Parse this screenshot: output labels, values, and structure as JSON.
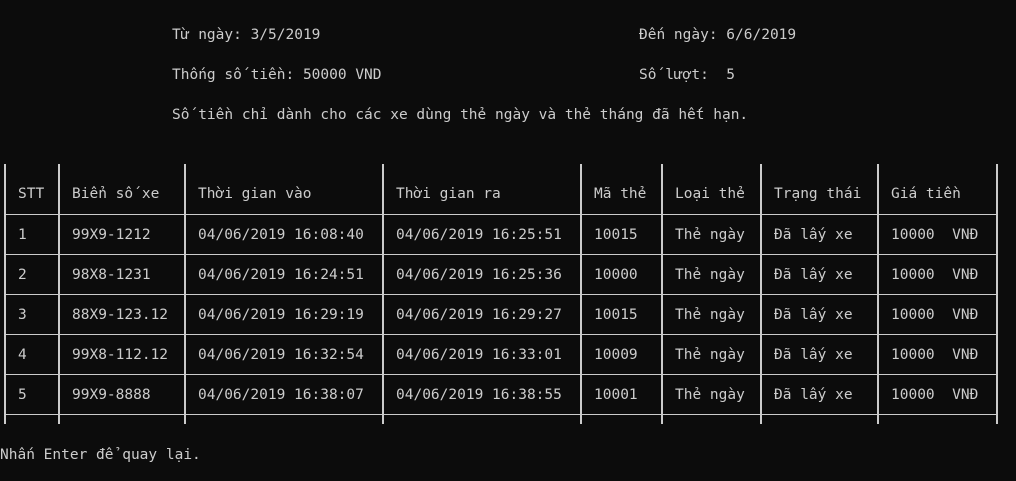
{
  "header": {
    "from_date": "Từ ngày: 3/5/2019",
    "to_date": "Đến ngày: 6/6/2019",
    "total_money": "Thống số tiền: 50000 VND",
    "count": "Số lượt:  5",
    "note": "Số tiền chỉ dành cho các xe dùng thẻ ngày và thẻ tháng đã hết hạn."
  },
  "table": {
    "columns": [
      "STT",
      "Biển số xe",
      "Thời gian vào",
      "Thời gian ra",
      "Mã thẻ",
      "Loại thẻ",
      "Trạng thái",
      "Giá tiền"
    ],
    "rows": [
      [
        "1",
        "99X9-1212",
        "04/06/2019 16:08:40",
        "04/06/2019 16:25:51",
        "10015",
        "Thẻ ngày",
        "Đã lấy xe",
        "10000  VNĐ"
      ],
      [
        "2",
        "98X8-1231",
        "04/06/2019 16:24:51",
        "04/06/2019 16:25:36",
        "10000",
        "Thẻ ngày",
        "Đã lấy xe",
        "10000  VNĐ"
      ],
      [
        "3",
        "88X9-123.12",
        "04/06/2019 16:29:19",
        "04/06/2019 16:29:27",
        "10015",
        "Thẻ ngày",
        "Đã lấy xe",
        "10000  VNĐ"
      ],
      [
        "4",
        "99X8-112.12",
        "04/06/2019 16:32:54",
        "04/06/2019 16:33:01",
        "10009",
        "Thẻ ngày",
        "Đã lấy xe",
        "10000  VNĐ"
      ],
      [
        "5",
        "99X9-8888",
        "04/06/2019 16:38:07",
        "04/06/2019 16:38:55",
        "10001",
        "Thẻ ngày",
        "Đã lấy xe",
        "10000  VNĐ"
      ]
    ]
  },
  "footer": {
    "prompt": "Nhấn Enter để quay lại."
  },
  "colors": {
    "background": "#0c0c0c",
    "text": "#cccccc"
  }
}
